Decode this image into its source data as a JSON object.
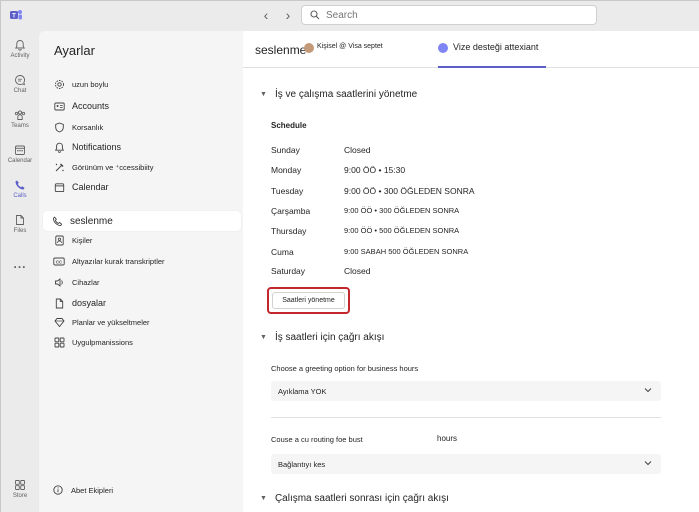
{
  "titlebar": {
    "search_placeholder": "Search"
  },
  "rail": {
    "items": [
      {
        "label": "Activity",
        "icon": "bell-icon"
      },
      {
        "label": "Chat",
        "icon": "chat-icon"
      },
      {
        "label": "Teams",
        "icon": "teams-icon"
      },
      {
        "label": "Calendar",
        "icon": "calendar-icon"
      },
      {
        "label": "Calls",
        "icon": "phone-icon",
        "active": true
      },
      {
        "label": "Files",
        "icon": "file-icon"
      },
      {
        "label": "...",
        "icon": "more-icon"
      },
      {
        "label": "Store",
        "icon": "apps-icon"
      }
    ],
    "accent": "#5b5fc7"
  },
  "sidebar": {
    "title": "Ayarlar",
    "items": [
      {
        "label": "uzun boylu",
        "icon": "gear-icon"
      },
      {
        "label": "Accounts",
        "icon": "id-card-icon"
      },
      {
        "label": "Korsanlık",
        "icon": "shield-icon"
      },
      {
        "label": "Notifications",
        "icon": "bell-icon"
      },
      {
        "label": "Görünüm ve ⁺ccessibiity",
        "icon": "paint-icon"
      },
      {
        "label": "Calendar",
        "icon": "calendar-icon"
      },
      {
        "label": "seslenme",
        "icon": "phone-icon",
        "selected": true
      },
      {
        "label": "Kişiler",
        "icon": "contact-icon"
      },
      {
        "label": "Altyazılar kurak transkriptler",
        "icon": "cc-icon"
      },
      {
        "label": "Cihazlar",
        "icon": "speaker-icon"
      },
      {
        "label": "dosyalar",
        "icon": "file-icon"
      },
      {
        "label": "Planlar ve yükseltmeler",
        "icon": "diamond-icon"
      },
      {
        "label": "Uygulpmanissions",
        "icon": "apps-icon"
      }
    ],
    "footer": {
      "label": "Abet Ekipleri",
      "icon": "info-icon"
    }
  },
  "main": {
    "title": "seslenme",
    "subtitle": "Kişisel @ Visa septet",
    "tab": "Vize desteği attexiant",
    "section1": {
      "heading": "İş ve çalışma saatlerini yönetme",
      "schedule_title": "Schedule",
      "schedule": [
        {
          "day": "Sunday",
          "hours": "Closed"
        },
        {
          "day": "Monday",
          "hours": "9:00 ÖÖ • 15:30"
        },
        {
          "day": "Tuesday",
          "hours": "9:00 ÖÖ • 300 ÖĞLEDEN SONRA"
        },
        {
          "day": "Çarşamba",
          "hours": "9:00 ÖÖ • 300 ÖĞLEDEN SONRA"
        },
        {
          "day": "Thursday",
          "hours": "9:00 ÖÖ • 500 ÖĞLEDEN SONRA"
        },
        {
          "day": "Cuma",
          "hours": "9:00 SABAH 500 ÖĞLEDEN SONRA"
        },
        {
          "day": "Saturday",
          "hours": "Closed"
        }
      ],
      "manage_button": "Saatleri yönetme"
    },
    "section2": {
      "heading": "İş saatleri için çağrı akışı",
      "greeting_label": "Choose a greeting option for business hours",
      "greeting_value": "Ayıklama YOK",
      "routing_label": "Couse a cu routing foe bust",
      "routing_label_suffix": "hours",
      "routing_value": "Bağlantıyı kes"
    },
    "section3": {
      "heading": "Çalışma saatleri sonrası için çağrı akışı"
    }
  },
  "colors": {
    "highlight_ring": "#c4262e",
    "tab_underline": "#5b5fc7"
  }
}
